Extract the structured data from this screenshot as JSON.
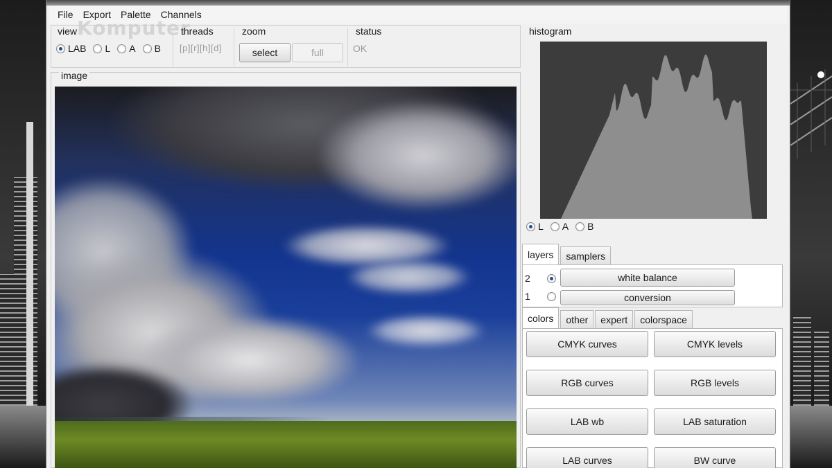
{
  "menu": [
    "File",
    "Export",
    "Palette",
    "Channels"
  ],
  "watermark_text": "Komputer",
  "controls": {
    "view_label": "view",
    "view_options": [
      "LAB",
      "L",
      "A",
      "B"
    ],
    "view_selected": "LAB",
    "threads_label": "threads",
    "threads_value": "[p][r][h][d]",
    "zoom_label": "zoom",
    "zoom_select": "select",
    "zoom_full": "full",
    "status_label": "status",
    "status_value": "OK"
  },
  "image_label": "image",
  "histogram": {
    "label": "histogram",
    "channels": [
      "L",
      "A",
      "B"
    ],
    "selected": "L"
  },
  "layers_tabs": [
    "layers",
    "samplers"
  ],
  "layers": [
    {
      "num": "2",
      "name": "white balance",
      "selected": true
    },
    {
      "num": "1",
      "name": "conversion",
      "selected": false
    }
  ],
  "tool_tabs": [
    "colors",
    "other",
    "expert",
    "colorspace"
  ],
  "tools": [
    "CMYK curves",
    "CMYK levels",
    "RGB curves",
    "RGB levels",
    "LAB wb",
    "LAB saturation",
    "LAB curves",
    "BW curve"
  ],
  "colors": {
    "hist_bg": "#3c3c3c",
    "hist_fill": "#8e8e8e",
    "radio_dot": "#1f4f8f"
  }
}
